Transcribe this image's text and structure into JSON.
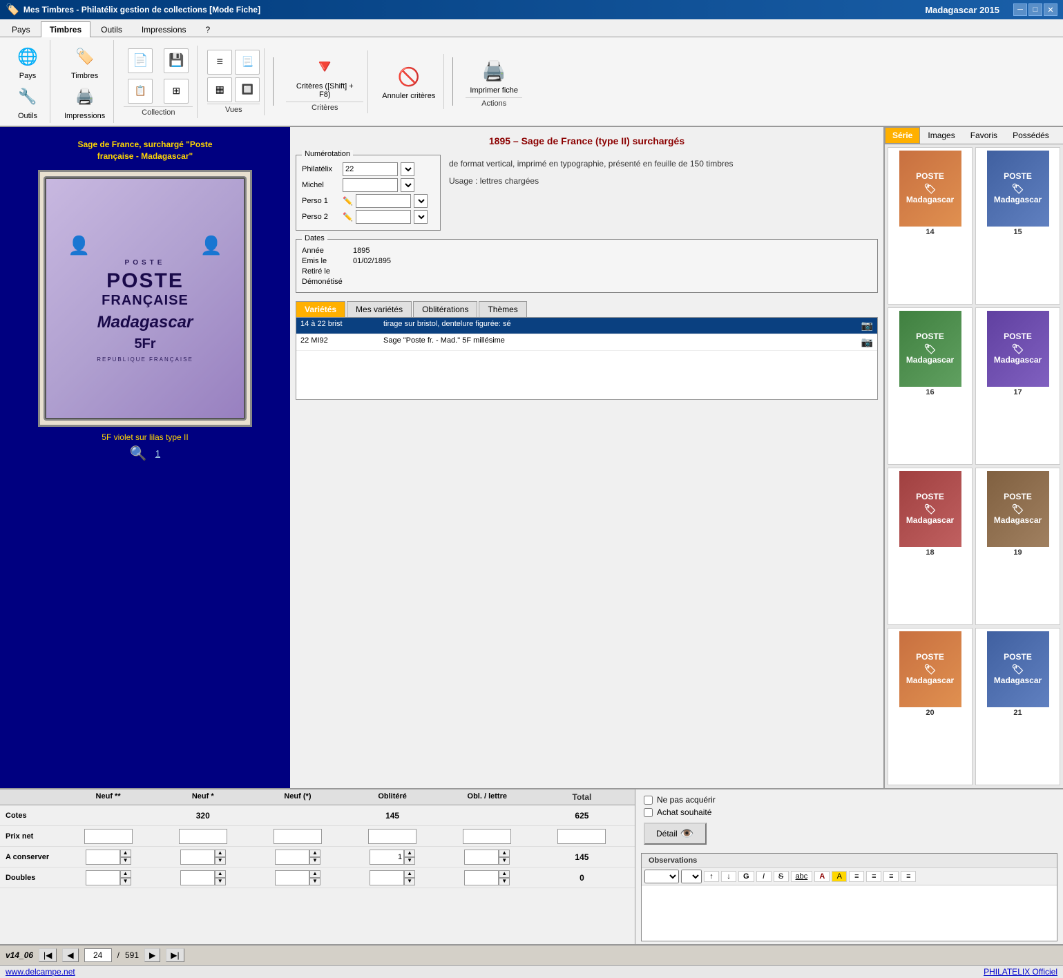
{
  "app": {
    "title": "Mes Timbres - Philatélix gestion de collections [Mode Fiche]",
    "window_right_title": "Madagascar 2015",
    "minimize": "─",
    "maximize": "□",
    "close": "✕"
  },
  "menu": {
    "tabs": [
      "Pays",
      "Timbres",
      "Outils",
      "Impressions",
      "?"
    ],
    "active_tab": "Timbres"
  },
  "toolbar": {
    "pays_label": "Pays",
    "timbres_label": "Timbres",
    "outils_label": "Outils",
    "impressions_label": "Impressions",
    "collection_label": "Collection",
    "vues_label": "Vues",
    "criteres_label": "Critères ([Shift] + F8)",
    "annuler_criteres_label": "Annuler critères",
    "imprimer_fiche_label": "Imprimer fiche",
    "actions_label": "Actions",
    "criteres_section": "Critères"
  },
  "stamp": {
    "title_line1": "Sage de France, surchargé \"Poste",
    "title_line2": "française - Madagascar\"",
    "poste": "POSTE",
    "poste_grande": "POSTE",
    "francaise": "FRANÇAISE",
    "madagascar": "Madagascar",
    "denomination": "5Fr",
    "republique": "REPUBLIQUE FRANÇAISE",
    "subtitle": "5F violet sur lilas type II",
    "number": "1"
  },
  "numerotation": {
    "legend": "Numérotation",
    "philatelix_label": "Philatélix",
    "philatelix_value": "22",
    "michel_label": "Michel",
    "michel_value": "",
    "perso1_label": "Perso 1",
    "perso1_value": "",
    "perso2_label": "Perso 2",
    "perso2_value": ""
  },
  "description": {
    "text1": "de format vertical, imprimé en typographie, présenté en feuille de 150 timbres",
    "usage": "Usage :  lettres chargées"
  },
  "dates": {
    "legend": "Dates",
    "annee_label": "Année",
    "annee_value": "1895",
    "emis_label": "Emis le",
    "emis_value": "01/02/1895",
    "retire_label": "Retiré le",
    "retire_value": "",
    "demonetise_label": "Démonétisé",
    "demonetise_value": ""
  },
  "series_title": "1895 – Sage de France (type II) surchargés",
  "tabs": {
    "varietes": "Variétés",
    "mes_varietes": "Mes variétés",
    "obliterations": "Oblitérations",
    "themes": "Thèmes",
    "active": "varietes"
  },
  "varietes_rows": [
    {
      "col1": "14 à 22 brist",
      "col2": "tirage sur bristol, dentelure figurée: sé",
      "has_icon": true,
      "selected": true
    },
    {
      "col1": "22 MI92",
      "col2": "Sage \"Poste fr. - Mad.\" 5F millésime",
      "has_icon": true,
      "selected": false
    }
  ],
  "right_panel": {
    "tabs": [
      "Série",
      "Images",
      "Favoris",
      "Possédés"
    ],
    "active_tab": "Série",
    "thumbnails": [
      {
        "number": "14",
        "color": "orange"
      },
      {
        "number": "15",
        "color": "blue"
      },
      {
        "number": "16",
        "color": "green"
      },
      {
        "number": "17",
        "color": "purple"
      },
      {
        "number": "18",
        "color": "red"
      },
      {
        "number": "19",
        "color": "brown"
      },
      {
        "number": "20",
        "color": "orange"
      },
      {
        "number": "21",
        "color": "blue"
      }
    ]
  },
  "bottom": {
    "headers": [
      "Neuf **",
      "Neuf *",
      "Neuf (*)",
      "Oblitéré",
      "Obl. / lettre",
      "Total"
    ],
    "rows": [
      {
        "label": "Cotes",
        "values": [
          "",
          "320",
          "",
          "145",
          "",
          "625"
        ],
        "bold_cols": [
          1,
          3,
          5
        ]
      },
      {
        "label": "Prix net",
        "values": [
          "",
          "",
          "",
          "",
          "",
          ""
        ],
        "bold_cols": []
      },
      {
        "label": "A conserver",
        "values": [
          "",
          "",
          "",
          "1",
          "",
          "145"
        ],
        "has_stepper": [
          false,
          false,
          false,
          true,
          false,
          false
        ],
        "total": "145"
      },
      {
        "label": "Doubles",
        "values": [
          "",
          "",
          "",
          "",
          "",
          "0"
        ],
        "total": "0"
      }
    ]
  },
  "acquisition": {
    "ne_pas_acquerir": "Ne pas acquérir",
    "achat_souhaite": "Achat souhaité",
    "detail_btn": "Détail"
  },
  "observations": {
    "label": "Observations",
    "toolbar_buttons": [
      "▼",
      "▼",
      "↑",
      "↓",
      "G",
      "I",
      "S",
      "abc",
      "A",
      "A",
      "≡",
      "≡",
      "≡",
      "≡"
    ]
  },
  "statusbar": {
    "version": "v14_06",
    "current_page": "24",
    "total_pages": "591"
  },
  "footer": {
    "website": "www.delcampe.net",
    "brand": "PHILATELIX Officiel"
  }
}
